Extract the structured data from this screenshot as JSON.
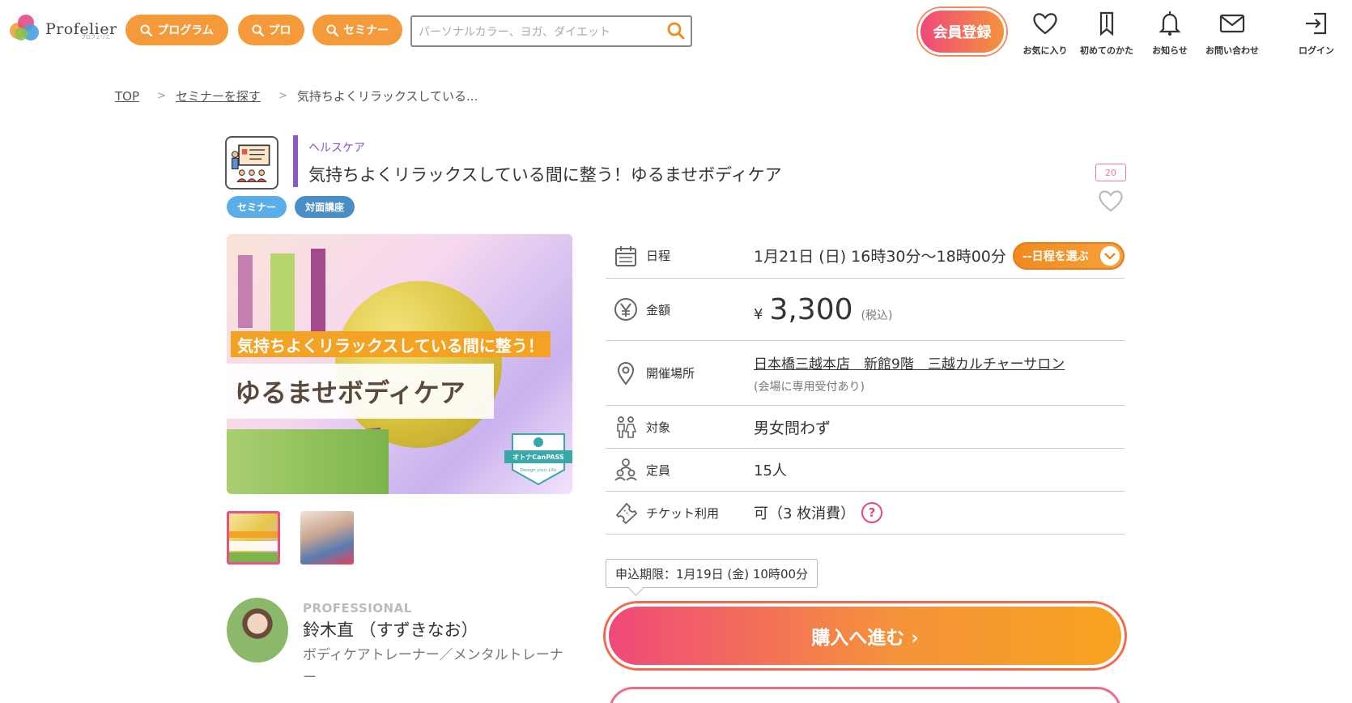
{
  "header": {
    "logo_text": "Profelier",
    "logo_sub": "プロフェリエ",
    "nav_pills": [
      {
        "label": "プログラム"
      },
      {
        "label": "プロ"
      },
      {
        "label": "セミナー"
      }
    ],
    "search_placeholder": "パーソナルカラー、ヨガ、ダイエット",
    "member_button": "会員登録",
    "icons": [
      {
        "icon": "heart-icon",
        "label": "お気に入り"
      },
      {
        "icon": "bookmark-icon",
        "label": "初めてのかた"
      },
      {
        "icon": "bell-icon",
        "label": "お知らせ"
      },
      {
        "icon": "mail-icon",
        "label": "お問い合わせ"
      },
      {
        "icon": "login-icon",
        "label": "ログイン"
      }
    ]
  },
  "breadcrumb": {
    "items": [
      "TOP",
      "セミナーを探す",
      "気持ちよくリラックスしている..."
    ]
  },
  "program": {
    "category": "ヘルスケア",
    "title": "気持ちよくリラックスしている間に整う！ゆるませボディケア",
    "tags": [
      "セミナー",
      "対面講座"
    ],
    "favorite_count": "20",
    "image_caption_top": "気持ちよくリラックスしている間に整う！",
    "image_caption_main": "ゆるませボディケア",
    "badge_text": "オトナCanPASS",
    "badge_sub": "Design your Life"
  },
  "professional": {
    "label": "PROFESSIONAL",
    "name": "鈴木直 （すずきなお）",
    "role": "ボディケアトレーナー／メンタルトレーナー"
  },
  "details": {
    "schedule_label": "日程",
    "schedule_value": "1月21日 (日) 16時30分〜18時00分",
    "schedule_button": "--日程を選ぶ",
    "price_label": "金額",
    "price_yen": "¥",
    "price_value": "3,300",
    "price_tax": "(税込)",
    "venue_label": "開催場所",
    "venue_value": "日本橋三越本店　新館9階　三越カルチャーサロン",
    "venue_note": "(会場に専用受付あり)",
    "target_label": "対象",
    "target_value": "男女問わず",
    "capacity_label": "定員",
    "capacity_value": "15人",
    "ticket_label": "チケット利用",
    "ticket_value": "可（3 枚消費）",
    "help_mark": "?"
  },
  "deadline": "申込期限：1月19日 (金) 10時00分",
  "buy_button": "購入へ進む ›",
  "colors": {
    "accent_orange": "#f59a3b",
    "accent_pink": "#f0497a",
    "category_purple": "#8e56c8",
    "tag_blue": "#5aaee8"
  }
}
